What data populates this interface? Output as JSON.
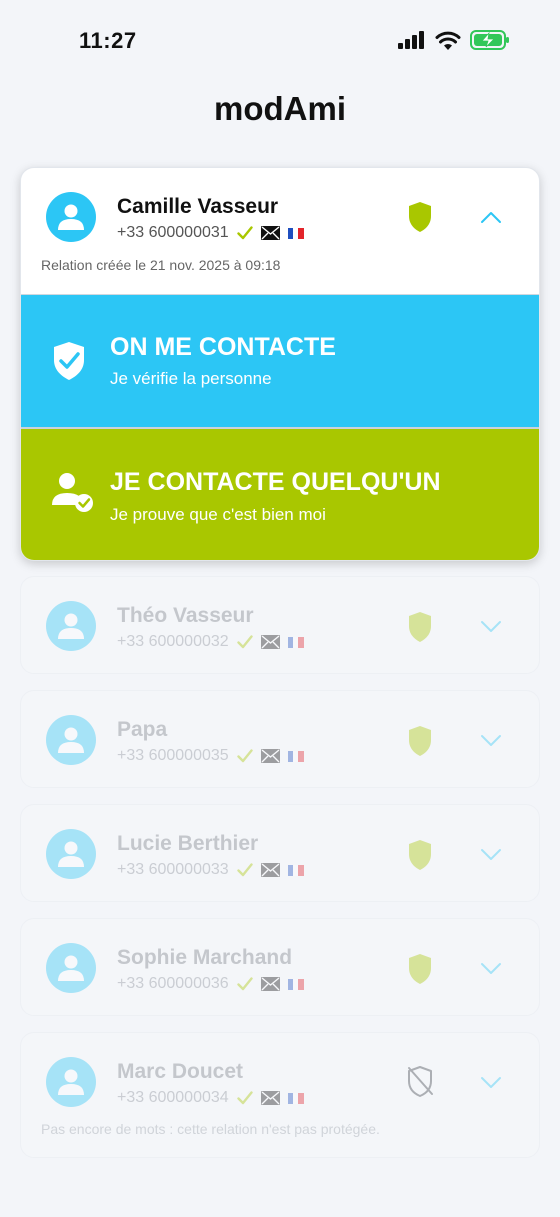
{
  "status": {
    "time": "11:27"
  },
  "app": {
    "title": "modAmi"
  },
  "expanded_contact": {
    "name": "Camille Vasseur",
    "phone": "+33 600000031",
    "relation_text": "Relation créée le 21 nov. 2025 à 09:18",
    "actions": [
      {
        "title": "ON ME CONTACTE",
        "subtitle": "Je vérifie la personne",
        "color": "#2cc6f5",
        "icon": "shield-check-icon"
      },
      {
        "title": "JE CONTACTE QUELQU'UN",
        "subtitle": "Je prouve que c'est bien moi",
        "color": "#a9c700",
        "icon": "user-check-icon"
      }
    ]
  },
  "contacts": [
    {
      "name": "Théo Vasseur",
      "phone": "+33 600000032",
      "protected": true
    },
    {
      "name": "Papa",
      "phone": "+33 600000035",
      "protected": true
    },
    {
      "name": "Lucie Berthier",
      "phone": "+33 600000033",
      "protected": true
    },
    {
      "name": "Sophie Marchand",
      "phone": "+33 600000036",
      "protected": true
    },
    {
      "name": "Marc Doucet",
      "phone": "+33 600000034",
      "protected": false,
      "note": "Pas encore de mots : cette relation n'est pas protégée."
    }
  ],
  "colors": {
    "accent_blue": "#2cc6f5",
    "accent_green": "#a9c700",
    "background": "#f3f5f9"
  }
}
